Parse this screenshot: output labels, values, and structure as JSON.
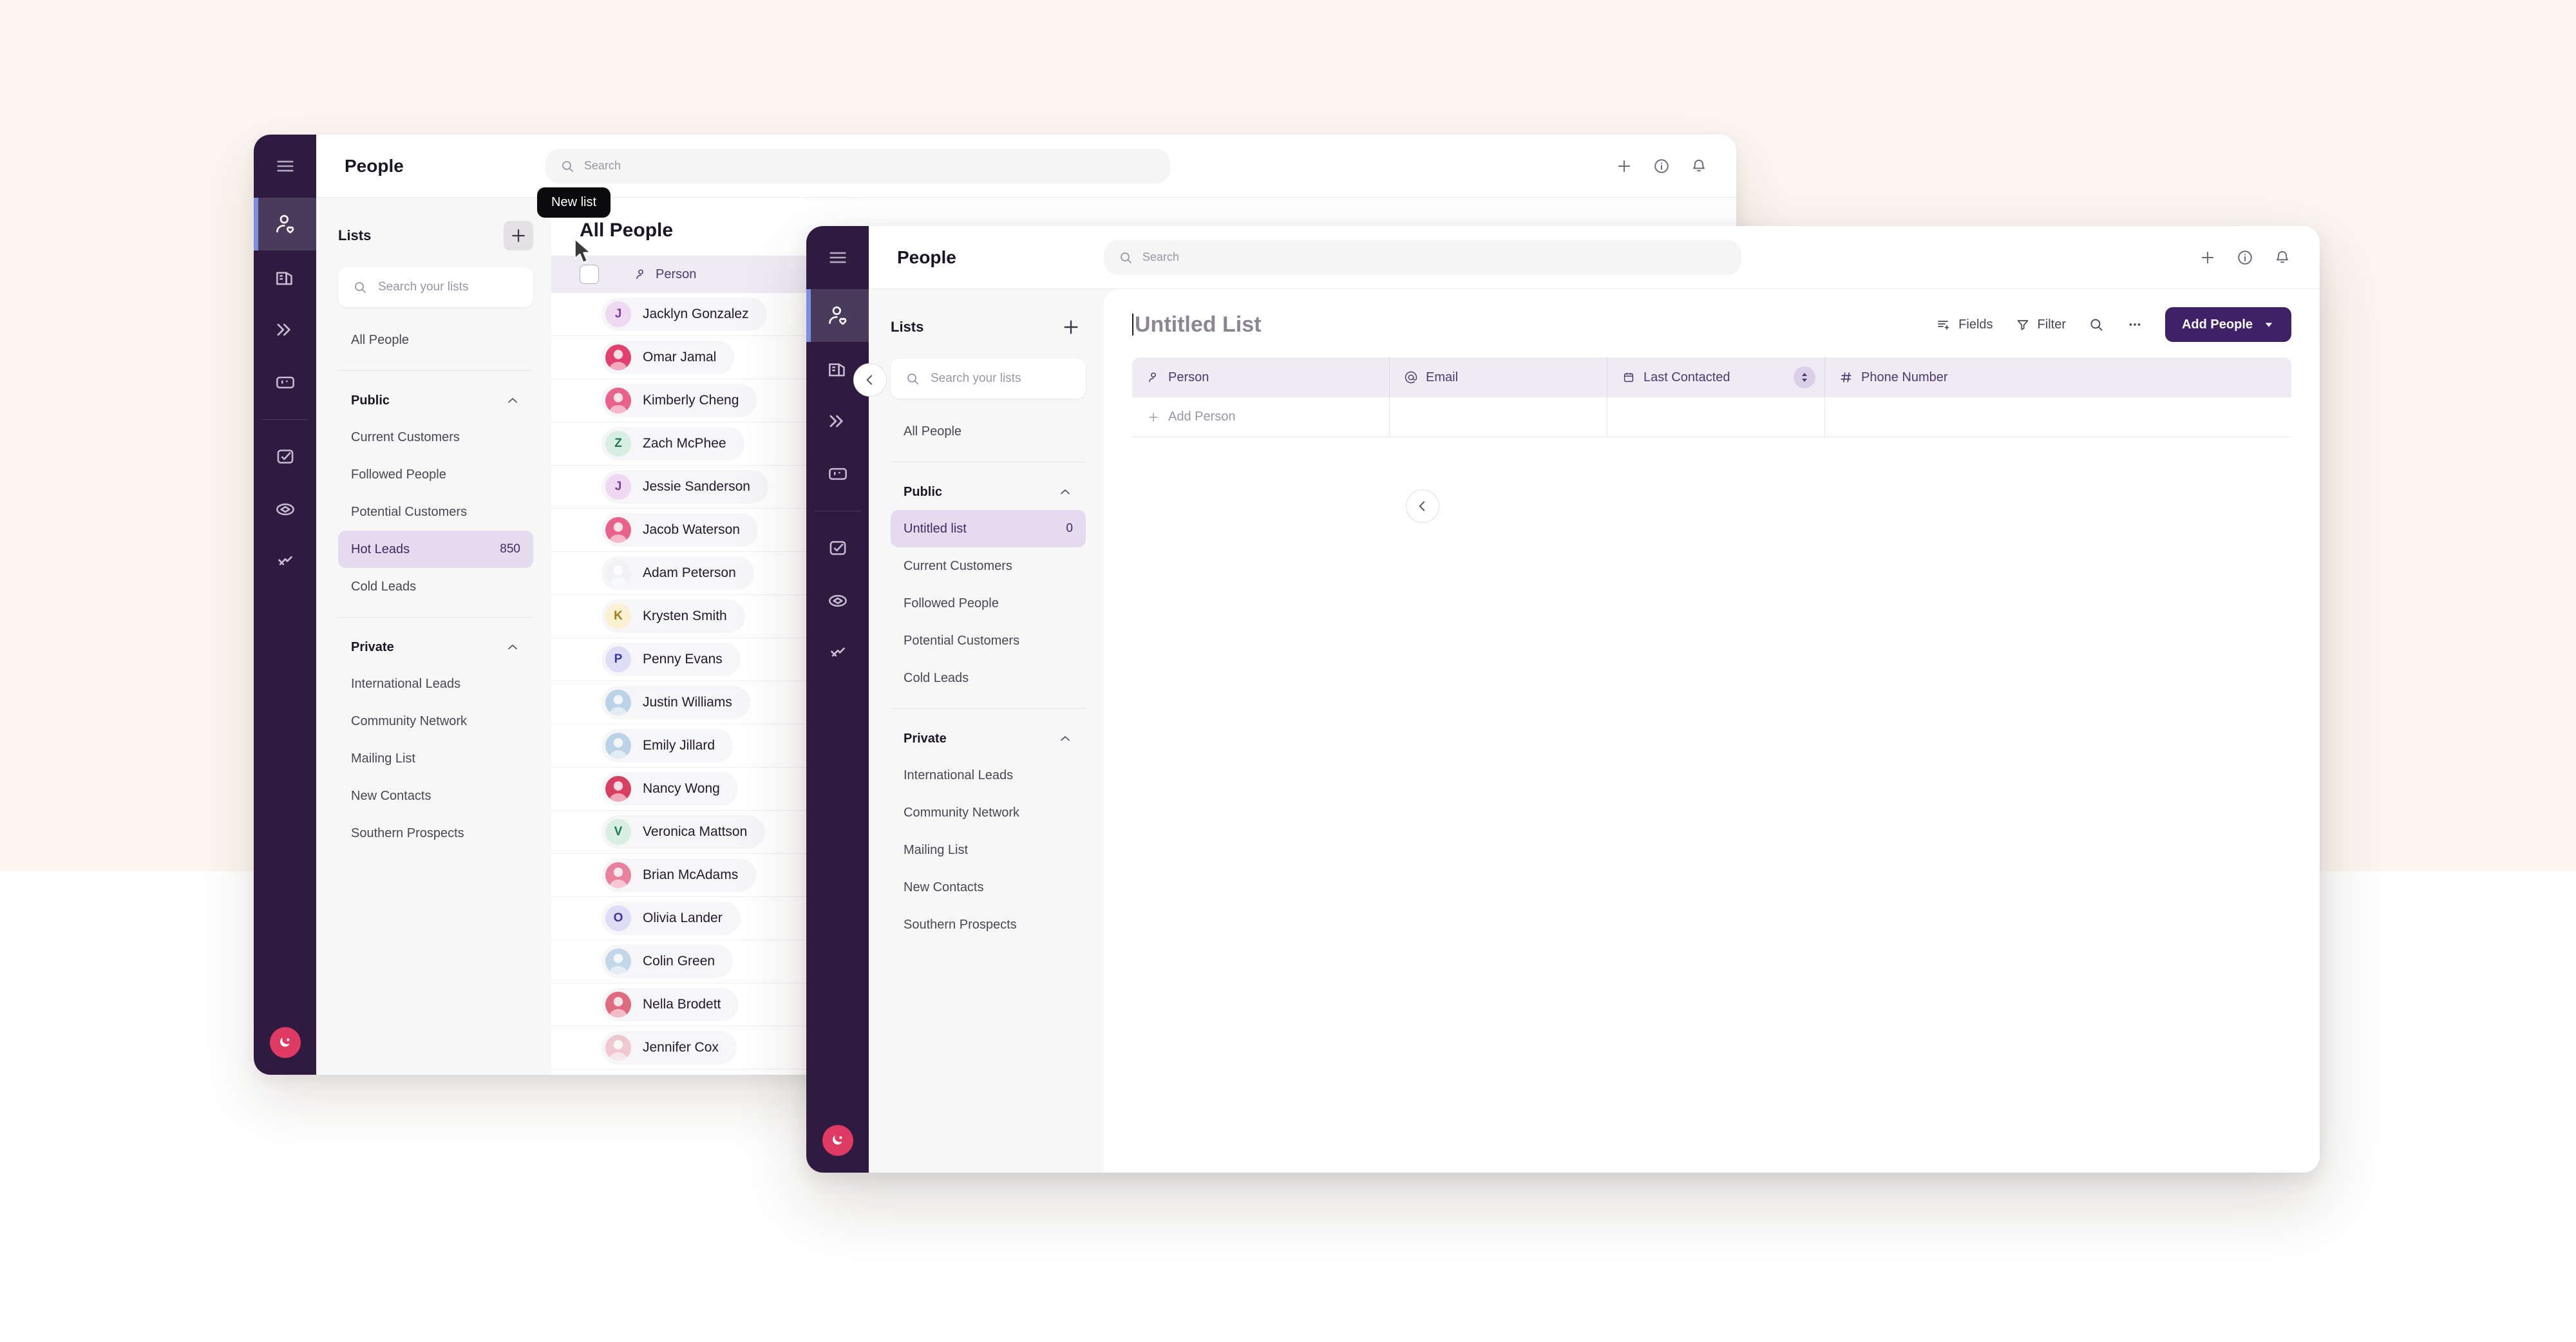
{
  "background": {
    "top_color": "#FBF7F0",
    "bottom_color": "#FFFFFF"
  },
  "theme": {
    "rail": "#2E1B3F",
    "accent": "#3E2166",
    "selected_bg": "#E4DCEE",
    "brand_avatar": "#DE3A63"
  },
  "back_window": {
    "topbar": {
      "title": "People",
      "search_placeholder": "Search"
    },
    "rail": {
      "hamburger": "hamburger-icon",
      "items": [
        {
          "icon": "person-heart-icon",
          "name": "people",
          "active": true
        },
        {
          "icon": "company-building-icon",
          "name": "companies",
          "active": false
        },
        {
          "icon": "double-chevron-icon",
          "name": "sequences",
          "active": false
        },
        {
          "icon": "board-columns-icon",
          "name": "boards",
          "active": false
        },
        {
          "icon": "task-check-icon",
          "name": "tasks",
          "active": false
        },
        {
          "icon": "deals-icon",
          "name": "deals",
          "active": false
        },
        {
          "icon": "lightning-icon",
          "name": "automations",
          "active": false
        }
      ],
      "avatar_letter": "C"
    },
    "lists": {
      "title": "Lists",
      "new_list_tooltip": "New list",
      "search_placeholder": "Search your lists",
      "all_people": "All People",
      "groups": [
        {
          "label": "Public",
          "items": [
            {
              "label": "Current Customers",
              "count": "",
              "selected": false
            },
            {
              "label": "Followed People",
              "count": "",
              "selected": false
            },
            {
              "label": "Potential Customers",
              "count": "",
              "selected": false
            },
            {
              "label": "Hot Leads",
              "count": "850",
              "selected": true
            },
            {
              "label": "Cold Leads",
              "count": "",
              "selected": false
            }
          ]
        },
        {
          "label": "Private",
          "items": [
            {
              "label": "International Leads",
              "count": "",
              "selected": false
            },
            {
              "label": "Community Network",
              "count": "",
              "selected": false
            },
            {
              "label": "Mailing List",
              "count": "",
              "selected": false
            },
            {
              "label": "New Contacts",
              "count": "",
              "selected": false
            },
            {
              "label": "Southern Prospects",
              "count": "",
              "selected": false
            }
          ]
        }
      ]
    },
    "content": {
      "title": "All People",
      "column_header": "Person",
      "people": [
        {
          "name": "Jacklyn Gonzalez",
          "initial": "J",
          "bg": "#EFD9F2",
          "fg": "#7A3E9B",
          "photo": false
        },
        {
          "name": "Omar Jamal",
          "initial": "O",
          "bg": "#E0416F",
          "fg": "#ffffff",
          "photo": true
        },
        {
          "name": "Kimberly Cheng",
          "initial": "K",
          "bg": "#E8628C",
          "fg": "#ffffff",
          "photo": true
        },
        {
          "name": "Zach McPhee",
          "initial": "Z",
          "bg": "#D6EFE2",
          "fg": "#1D7A52",
          "photo": false
        },
        {
          "name": "Jessie Sanderson",
          "initial": "J",
          "bg": "#EFD9F2",
          "fg": "#7A3E9B",
          "photo": false
        },
        {
          "name": "Jacob Waterson",
          "initial": "J",
          "bg": "#E8628C",
          "fg": "#ffffff",
          "photo": true
        },
        {
          "name": "Adam Peterson",
          "initial": "A",
          "bg": "#F0F2F6",
          "fg": "#2E3A63",
          "photo": true
        },
        {
          "name": "Krysten Smith",
          "initial": "K",
          "bg": "#FBF0D2",
          "fg": "#A07C18",
          "photo": false
        },
        {
          "name": "Penny Evans",
          "initial": "P",
          "bg": "#DEDDF7",
          "fg": "#3A36A0",
          "photo": false
        },
        {
          "name": "Justin Williams",
          "initial": "J",
          "bg": "#BBD3E6",
          "fg": "#ffffff",
          "photo": true
        },
        {
          "name": "Emily Jillard",
          "initial": "E",
          "bg": "#BBD3E6",
          "fg": "#ffffff",
          "photo": true
        },
        {
          "name": "Nancy Wong",
          "initial": "N",
          "bg": "#D93F60",
          "fg": "#ffffff",
          "photo": true
        },
        {
          "name": "Veronica Mattson",
          "initial": "V",
          "bg": "#D6EFE2",
          "fg": "#1D7A52",
          "photo": false
        },
        {
          "name": "Brian McAdams",
          "initial": "B",
          "bg": "#E8809E",
          "fg": "#ffffff",
          "photo": true
        },
        {
          "name": "Olivia Lander",
          "initial": "O",
          "bg": "#DEDDF7",
          "fg": "#3A36A0",
          "photo": false
        },
        {
          "name": "Colin Green",
          "initial": "C",
          "bg": "#C2D7E8",
          "fg": "#ffffff",
          "photo": true
        },
        {
          "name": "Nella Brodett",
          "initial": "N",
          "bg": "#E06B7E",
          "fg": "#ffffff",
          "photo": true
        },
        {
          "name": "Jennifer Cox",
          "initial": "J",
          "bg": "#EFC7CE",
          "fg": "#ffffff",
          "photo": true
        }
      ]
    }
  },
  "front_window": {
    "topbar": {
      "title": "People",
      "search_placeholder": "Search"
    },
    "rail": {
      "hamburger": "hamburger-icon",
      "items": [
        {
          "icon": "person-heart-icon",
          "name": "people",
          "active": true
        },
        {
          "icon": "company-building-icon",
          "name": "companies",
          "active": false
        },
        {
          "icon": "double-chevron-icon",
          "name": "sequences",
          "active": false
        },
        {
          "icon": "board-columns-icon",
          "name": "boards",
          "active": false
        },
        {
          "icon": "task-check-icon",
          "name": "tasks",
          "active": false
        },
        {
          "icon": "deals-icon",
          "name": "deals",
          "active": false
        },
        {
          "icon": "lightning-icon",
          "name": "automations",
          "active": false
        }
      ],
      "avatar_letter": "C"
    },
    "lists": {
      "title": "Lists",
      "search_placeholder": "Search your lists",
      "all_people": "All People",
      "groups": [
        {
          "label": "Public",
          "items": [
            {
              "label": "Untitled list",
              "count": "0",
              "selected": true
            },
            {
              "label": "Current Customers",
              "count": "",
              "selected": false
            },
            {
              "label": "Followed People",
              "count": "",
              "selected": false
            },
            {
              "label": "Potential Customers",
              "count": "",
              "selected": false
            },
            {
              "label": "Cold Leads",
              "count": "",
              "selected": false
            }
          ]
        },
        {
          "label": "Private",
          "items": [
            {
              "label": "International Leads",
              "count": "",
              "selected": false
            },
            {
              "label": "Community Network",
              "count": "",
              "selected": false
            },
            {
              "label": "Mailing List",
              "count": "",
              "selected": false
            },
            {
              "label": "New Contacts",
              "count": "",
              "selected": false
            },
            {
              "label": "Southern Prospects",
              "count": "",
              "selected": false
            }
          ]
        }
      ]
    },
    "content": {
      "list_title": "Untitled List",
      "toolbar": {
        "fields": "Fields",
        "filter": "Filter",
        "search": "search-icon",
        "more": "more-options-icon",
        "add_people": "Add People"
      },
      "table": {
        "columns": [
          {
            "label": "Person",
            "icon": "person-icon",
            "sorted": false
          },
          {
            "label": "Email",
            "icon": "at-icon",
            "sorted": false
          },
          {
            "label": "Last Contacted",
            "icon": "calendar-icon",
            "sorted": true
          },
          {
            "label": "Phone Number",
            "icon": "hash-icon",
            "sorted": false
          }
        ],
        "add_row_label": "Add Person",
        "rows": []
      }
    }
  }
}
